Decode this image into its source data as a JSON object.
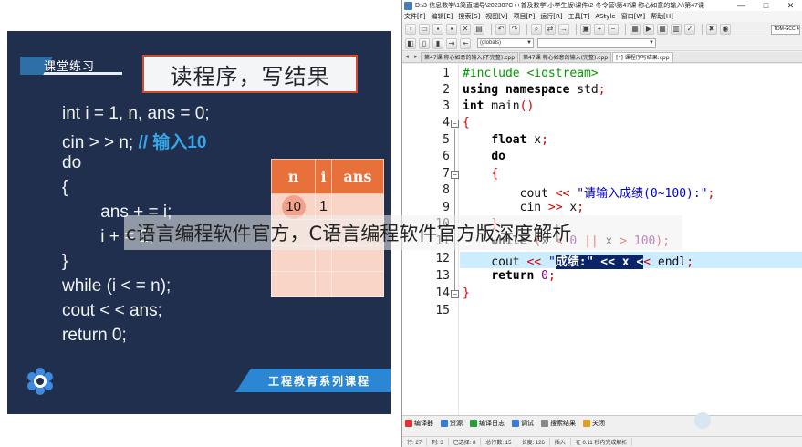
{
  "slide": {
    "section_label": "课堂练习",
    "title": "读程序，写结果",
    "code_lines": [
      {
        "text": "int i = 1, n, ans = 0;",
        "comment": ""
      },
      {
        "text": "cin > > n; ",
        "comment": "// 输入10"
      },
      {
        "text": "do",
        "comment": ""
      },
      {
        "text": "{",
        "comment": ""
      },
      {
        "text": "        ans + = i;",
        "comment": ""
      },
      {
        "text": "        i + = 2;",
        "comment": ""
      },
      {
        "text": "}",
        "comment": ""
      },
      {
        "text": "while (i < = n);",
        "comment": ""
      },
      {
        "text": "cout < < ans;",
        "comment": ""
      },
      {
        "text": "return 0;",
        "comment": ""
      }
    ],
    "table": {
      "headers": [
        "n",
        "i",
        "ans"
      ],
      "rows": [
        [
          "10",
          "1",
          ""
        ],
        [
          "",
          "",
          ""
        ],
        [
          "",
          "",
          ""
        ],
        [
          "",
          "",
          ""
        ]
      ]
    },
    "footer_banner": "工程教育系列课程",
    "colors": {
      "background": "#1f2f4d",
      "accent": "#e8703a",
      "title_border": "#d6492f",
      "comment": "#35a7e8"
    }
  },
  "ide": {
    "title": "D:\\3-信息数学\\1简直辅导\\202307C++普及数学\\小学生版\\课件\\2-冬令营\\第47课 称心如意的输入\\第47课",
    "window_controls": [
      "—",
      "□",
      "✕"
    ],
    "menu": [
      "文件[F]",
      "编辑[E]",
      "搜索[S]",
      "视图[V]",
      "项目[P]",
      "运行[R]",
      "工具[T]",
      "AStyle",
      "窗口[W]",
      "帮助[H]"
    ],
    "scope_combo": "(globals)",
    "compiler_combo": "TDM-GCC 4",
    "tabs": [
      "第47课 称心如意的输入(不完整).cpp",
      "第47课 称心如意的输入(完整).cpp",
      "[*] 课程序写结果.cpp"
    ],
    "active_tab_index": 2,
    "bottom_tabs": [
      {
        "label": "编译器",
        "icon": "compiler-icon"
      },
      {
        "label": "资源",
        "icon": "resources-icon"
      },
      {
        "label": "编译日志",
        "icon": "compile-log-icon"
      },
      {
        "label": "调试",
        "icon": "debug-icon"
      },
      {
        "label": "搜索结果",
        "icon": "search-results-icon"
      },
      {
        "label": "关闭",
        "icon": "close-icon"
      }
    ],
    "status": [
      "行:",
      "27",
      "列:",
      "3",
      "已选择:",
      "8",
      "总行数:",
      "15",
      "长度:",
      "126",
      "插入",
      "在 0.11 秒内完成解析"
    ]
  },
  "editor": {
    "line_numbers": [
      "1",
      "2",
      "3",
      "4",
      "5",
      "6",
      "7",
      "8",
      "9",
      "10",
      "11",
      "12",
      "13",
      "14",
      "15"
    ],
    "highlight_line": 12
  },
  "watermark": "c语言编程软件官方，C语言编程软件官方版深度解析"
}
